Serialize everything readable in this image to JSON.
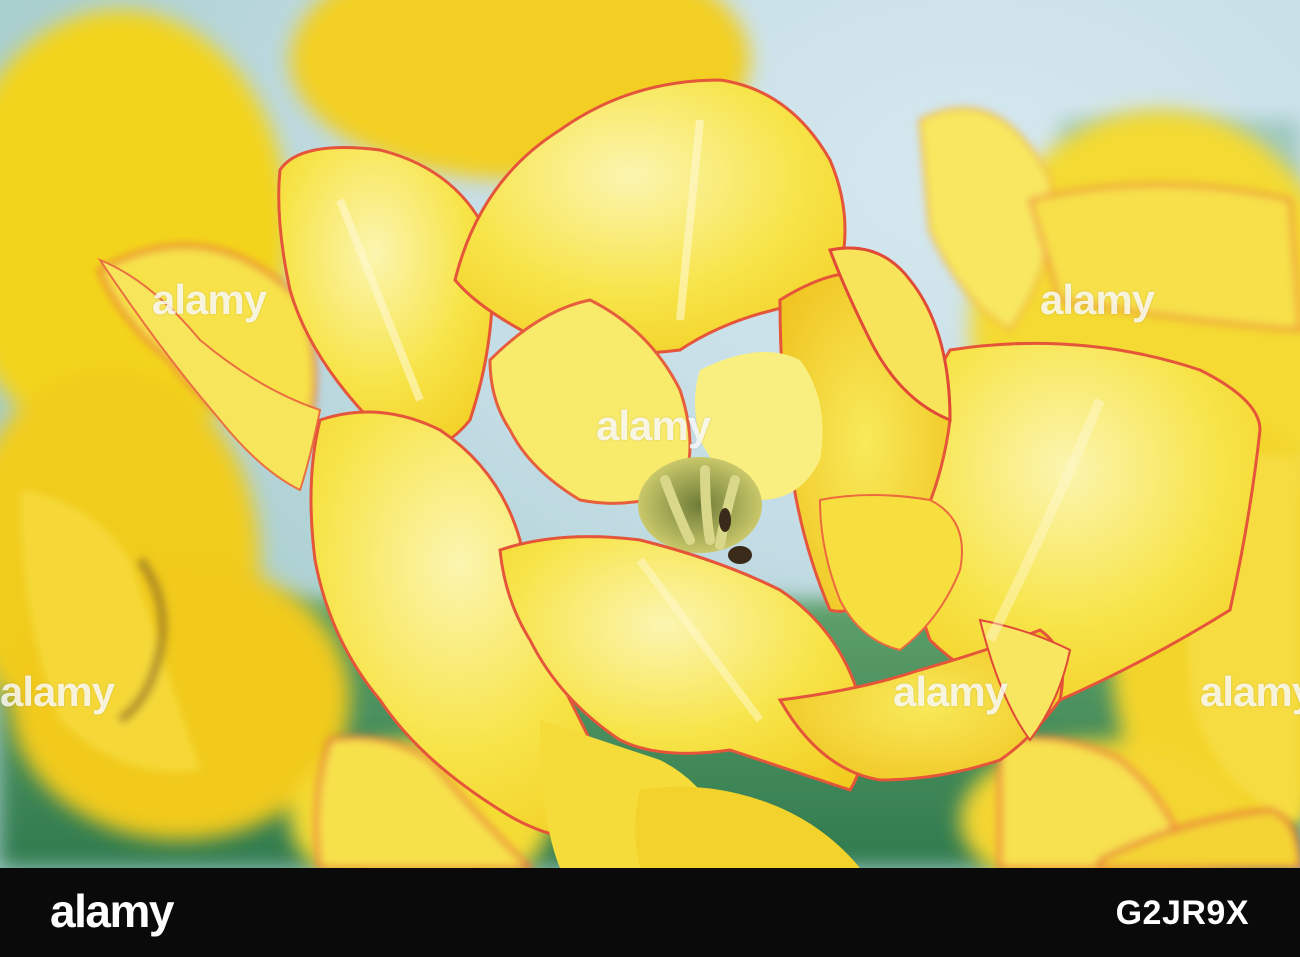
{
  "photo": {
    "subject": "yellow tulips with red-edged petals",
    "colors": {
      "petal_main": "#f6e23a",
      "petal_light": "#fbf29a",
      "petal_deep": "#f2c81c",
      "petal_edge": "#e85a3a",
      "background_sky": "#c6dde6",
      "background_leaf": "#3f8a5a",
      "center": "#8a9a4a"
    }
  },
  "watermark": {
    "text": "alamy"
  },
  "footer": {
    "logo": "alamy",
    "image_id": "G2JR9X",
    "background": "#0a0a0a"
  }
}
